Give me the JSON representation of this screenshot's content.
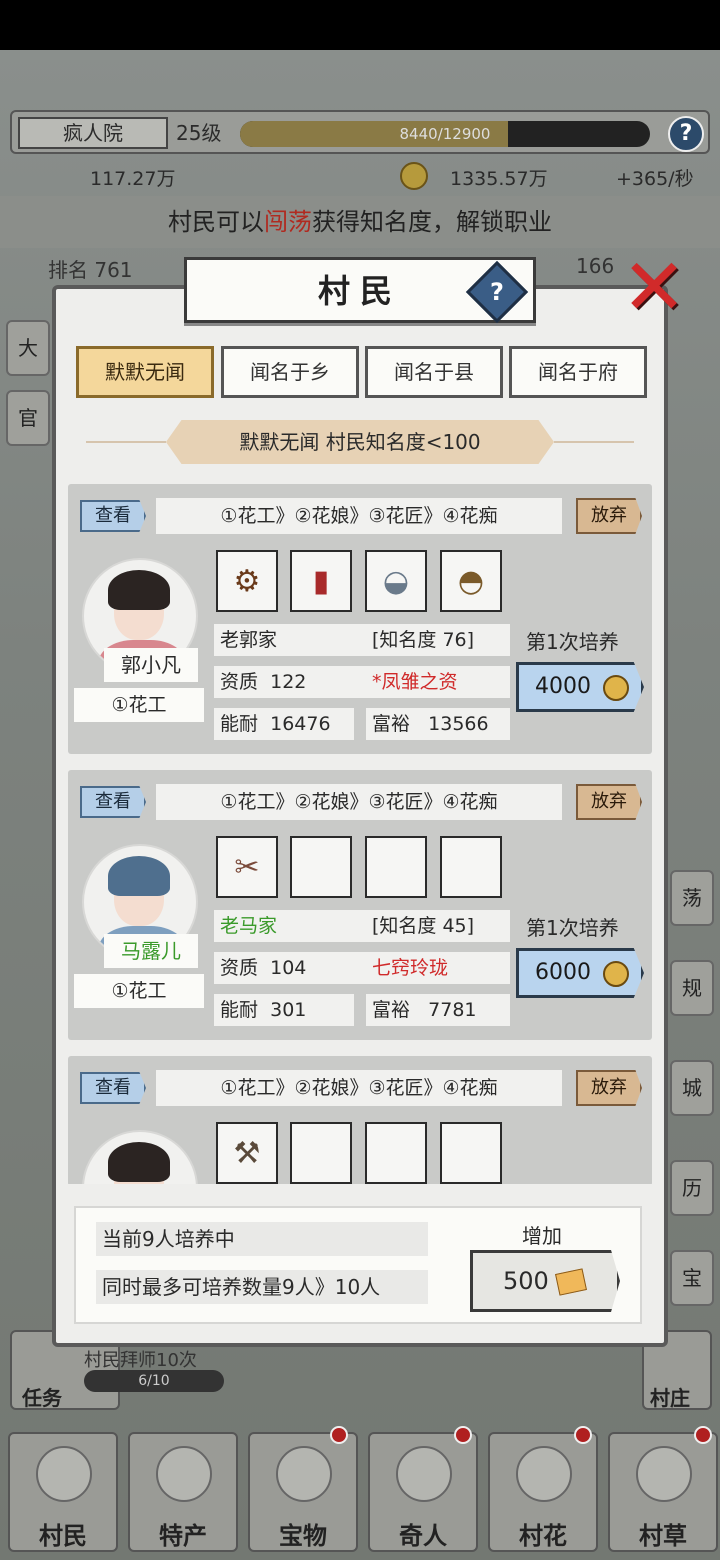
{
  "topbar": {
    "place": "疯人院",
    "level": "25级",
    "exp_text": "8440/12900",
    "exp_progress": 0.654
  },
  "resources": {
    "silver": "117.27万",
    "coins": "1335.57万",
    "rate": "+365/秒"
  },
  "banner": {
    "prefix": "村民可以",
    "highlight": "闯荡",
    "suffix": "获得知名度，解锁职业"
  },
  "rank": {
    "left": "排名 761",
    "right": "166"
  },
  "side_left": [
    "大",
    "官"
  ],
  "side_right": [
    "荡",
    "规",
    "城",
    "历",
    "宝"
  ],
  "panel": {
    "title": "村民",
    "help": "?",
    "close": "✕",
    "tabs": [
      {
        "label": "默默无闻",
        "active": true
      },
      {
        "label": "闻名于乡",
        "active": false
      },
      {
        "label": "闻名于县",
        "active": false
      },
      {
        "label": "闻名于府",
        "active": false
      }
    ],
    "ribbon": "默默无闻  村民知名度<100"
  },
  "villagers": [
    {
      "view": "查看",
      "path": "①花工》②花娘》③花匠》④花痴",
      "quit": "放弃",
      "name": "郭小凡",
      "job": "①花工",
      "items": [
        "spinning-wheel-icon",
        "red-gourd-icon",
        "rice-bowl-icon",
        "bronze-pot-icon"
      ],
      "family": "老郭家",
      "fame": "[知名度 76]",
      "aptitude_label": "资质",
      "aptitude": "122",
      "talent": "*凤雏之资",
      "ability_label": "能耐",
      "ability": "16476",
      "wealth_label": "富裕",
      "wealth": "13566",
      "train": "第1次培养",
      "cost": "4000"
    },
    {
      "view": "查看",
      "path": "①花工》②花娘》③花匠》④花痴",
      "quit": "放弃",
      "name": "马露儿",
      "job": "①花工",
      "items": [
        "fish-basket-icon"
      ],
      "family": "老马家",
      "fame": "[知名度 45]",
      "aptitude_label": "资质",
      "aptitude": "104",
      "talent": "七窍玲珑",
      "ability_label": "能耐",
      "ability": "301",
      "wealth_label": "富裕",
      "wealth": "7781",
      "train": "第1次培养",
      "cost": "6000"
    },
    {
      "view": "查看",
      "path": "①花工》②花娘》③花匠》④花痴",
      "quit": "放弃",
      "items": [
        "hoe-icon"
      ]
    }
  ],
  "footer": {
    "current": "当前9人培养中",
    "max": "同时最多可培养数量9人》10人",
    "add_label": "增加",
    "add_cost": "500"
  },
  "task": {
    "label": "任务",
    "line": "村民拜师10次",
    "progress_text": "6/10"
  },
  "village_btn": "村庄",
  "bottom_nav": [
    {
      "label": "村民",
      "dot": false
    },
    {
      "label": "特产",
      "dot": false
    },
    {
      "label": "宝物",
      "dot": true
    },
    {
      "label": "奇人",
      "dot": true
    },
    {
      "label": "村花",
      "dot": true
    },
    {
      "label": "村草",
      "dot": true
    }
  ]
}
